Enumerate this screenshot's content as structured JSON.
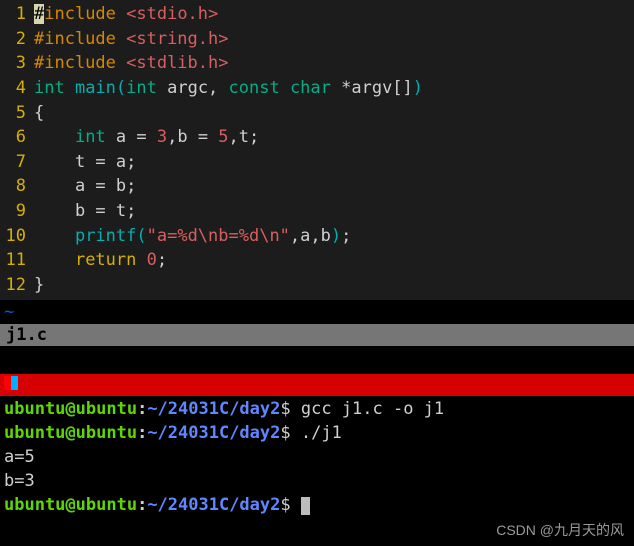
{
  "editor": {
    "lines": [
      {
        "n": "1",
        "tokens": [
          {
            "t": "#",
            "c": "pp hl"
          },
          {
            "t": "include ",
            "c": "pp"
          },
          {
            "t": "<stdio.h>",
            "c": "hdr"
          }
        ]
      },
      {
        "n": "2",
        "tokens": [
          {
            "t": "#include ",
            "c": "pp"
          },
          {
            "t": "<string.h>",
            "c": "hdr"
          }
        ]
      },
      {
        "n": "3",
        "tokens": [
          {
            "t": "#include ",
            "c": "pp"
          },
          {
            "t": "<stdlib.h>",
            "c": "hdr"
          }
        ]
      },
      {
        "n": "4",
        "tokens": [
          {
            "t": "int ",
            "c": "kw-type"
          },
          {
            "t": "main",
            "c": "fn"
          },
          {
            "t": "(",
            "c": "paren"
          },
          {
            "t": "int ",
            "c": "kw-type"
          },
          {
            "t": "argc, ",
            "c": "id"
          },
          {
            "t": "const char ",
            "c": "kw-type"
          },
          {
            "t": "*argv[]",
            "c": "id"
          },
          {
            "t": ")",
            "c": "paren"
          }
        ]
      },
      {
        "n": "5",
        "tokens": [
          {
            "t": "{",
            "c": "brace"
          }
        ]
      },
      {
        "n": "6",
        "tokens": [
          {
            "t": "    ",
            "c": "id"
          },
          {
            "t": "int ",
            "c": "kw-type"
          },
          {
            "t": "a = ",
            "c": "id"
          },
          {
            "t": "3",
            "c": "num"
          },
          {
            "t": ",b = ",
            "c": "id"
          },
          {
            "t": "5",
            "c": "num"
          },
          {
            "t": ",t;",
            "c": "id"
          }
        ]
      },
      {
        "n": "7",
        "tokens": [
          {
            "t": "    t = a;",
            "c": "id"
          }
        ]
      },
      {
        "n": "8",
        "tokens": [
          {
            "t": "    a = b;",
            "c": "id"
          }
        ]
      },
      {
        "n": "9",
        "tokens": [
          {
            "t": "    b = t;",
            "c": "id"
          }
        ]
      },
      {
        "n": "10",
        "tokens": [
          {
            "t": "    ",
            "c": "id"
          },
          {
            "t": "printf",
            "c": "fn"
          },
          {
            "t": "(",
            "c": "paren"
          },
          {
            "t": "\"a=%d\\nb=%d\\n\"",
            "c": "str"
          },
          {
            "t": ",a,b",
            "c": "id"
          },
          {
            "t": ")",
            "c": "paren"
          },
          {
            "t": ";",
            "c": "id"
          }
        ]
      },
      {
        "n": "11",
        "tokens": [
          {
            "t": "    ",
            "c": "id"
          },
          {
            "t": "return ",
            "c": "kw-ctrl"
          },
          {
            "t": "0",
            "c": "num"
          },
          {
            "t": ";",
            "c": "id"
          }
        ]
      },
      {
        "n": "12",
        "tokens": [
          {
            "t": "}",
            "c": "brace"
          }
        ]
      }
    ],
    "tilde": "~",
    "status": "j1.c"
  },
  "terminal": {
    "prompts": [
      {
        "user": "ubuntu@ubuntu",
        "colon": ":",
        "path": "~/24031C/day2",
        "dollar": "$ ",
        "cmd": "gcc j1.c -o j1"
      },
      {
        "user": "ubuntu@ubuntu",
        "colon": ":",
        "path": "~/24031C/day2",
        "dollar": "$ ",
        "cmd": "./j1"
      }
    ],
    "output": [
      "a=5",
      "b=3"
    ],
    "lastprompt": {
      "user": "ubuntu@ubuntu",
      "colon": ":",
      "path": "~/24031C/day2",
      "dollar": "$ "
    }
  },
  "watermark": "CSDN @九月天的风"
}
